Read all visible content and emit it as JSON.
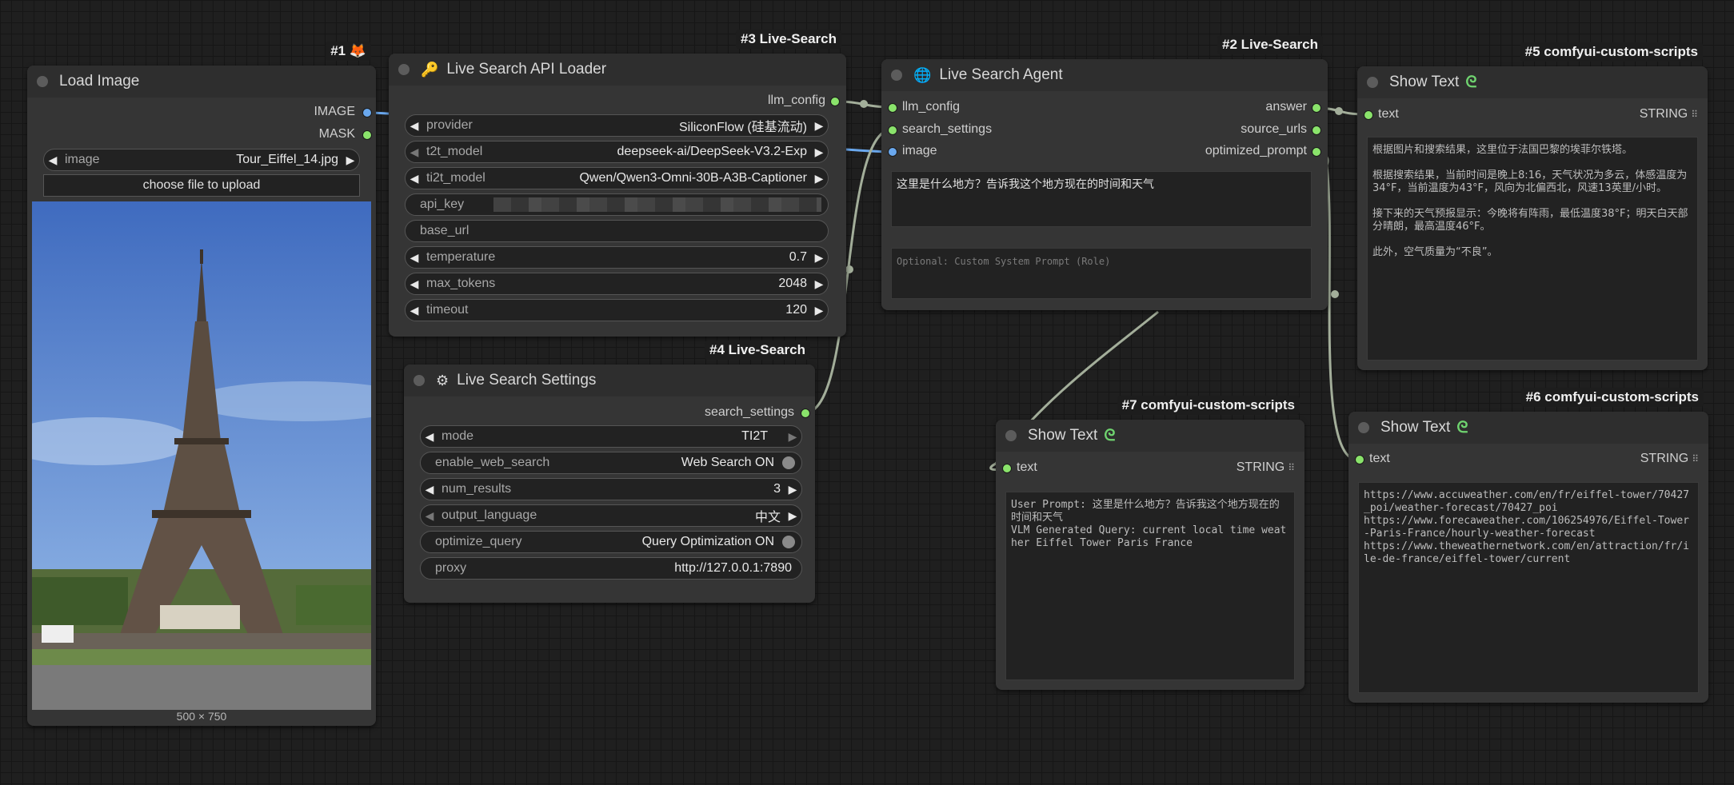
{
  "nodes": {
    "load_image": {
      "badge": "#1 🦊",
      "title": "Load Image",
      "outputs": [
        "IMAGE",
        "MASK"
      ],
      "image_widget": {
        "label": "image",
        "value": "Tour_Eiffel_14.jpg"
      },
      "upload_button": "choose file to upload",
      "image_size": "500 × 750"
    },
    "api_loader": {
      "badge": "#3 Live-Search",
      "title": "Live Search API Loader",
      "icon": "key-icon",
      "output": "llm_config",
      "widgets": [
        {
          "label": "provider",
          "value": "SiliconFlow (硅基流动)"
        },
        {
          "label": "t2t_model",
          "value": "deepseek-ai/DeepSeek-V3.2-Exp"
        },
        {
          "label": "ti2t_model",
          "value": "Qwen/Qwen3-Omni-30B-A3B-Captioner"
        },
        {
          "label": "api_key",
          "value": ""
        },
        {
          "label": "base_url",
          "value": ""
        },
        {
          "label": "temperature",
          "value": "0.7"
        },
        {
          "label": "max_tokens",
          "value": "2048"
        },
        {
          "label": "timeout",
          "value": "120"
        }
      ]
    },
    "settings": {
      "badge": "#4 Live-Search",
      "title": "Live Search Settings",
      "icon": "gear-icon",
      "output": "search_settings",
      "widgets": [
        {
          "label": "mode",
          "value": "TI2T"
        },
        {
          "label": "enable_web_search",
          "value": "Web Search ON"
        },
        {
          "label": "num_results",
          "value": "3"
        },
        {
          "label": "output_language",
          "value": "中文"
        },
        {
          "label": "optimize_query",
          "value": "Query Optimization ON"
        },
        {
          "label": "proxy",
          "value": "http://127.0.0.1:7890"
        }
      ]
    },
    "agent": {
      "badge": "#2 Live-Search",
      "title": "Live Search Agent",
      "icon": "globe-icon",
      "inputs": [
        "llm_config",
        "search_settings",
        "image"
      ],
      "outputs": [
        "answer",
        "source_urls",
        "optimized_prompt"
      ],
      "prompt": "这里是什么地方？告诉我这个地方现在的时间和天气",
      "system_prompt_placeholder": "Optional: Custom System Prompt (Role)"
    },
    "show5": {
      "badge": "#5 comfyui-custom-scripts",
      "title": "Show Text",
      "input": "text",
      "type": "STRING",
      "content": "根据图片和搜索结果，这里位于法国巴黎的埃菲尔铁塔。\n\n根据搜索结果，当前时间是晚上8:16，天气状况为多云，体感温度为34°F，当前温度为43°F，风向为北偏西北，风速13英里/小时。\n\n接下来的天气预报显示：今晚将有阵雨，最低温度38°F；明天白天部分晴朗，最高温度46°F。\n\n此外，空气质量为“不良”。"
    },
    "show6": {
      "badge": "#6 comfyui-custom-scripts",
      "title": "Show Text",
      "input": "text",
      "type": "STRING",
      "content": "https://www.accuweather.com/en/fr/eiffel-tower/70427_poi/weather-forecast/70427_poi\nhttps://www.forecaweather.com/106254976/Eiffel-Tower-Paris-France/hourly-weather-forecast\nhttps://www.theweathernetwork.com/en/attraction/fr/ile-de-france/eiffel-tower/current"
    },
    "show7": {
      "badge": "#7 comfyui-custom-scripts",
      "title": "Show Text",
      "input": "text",
      "type": "STRING",
      "content": "User Prompt: 这里是什么地方？告诉我这个地方现在的时间和天气\nVLM Generated Query: current local time weather Eiffel Tower Paris France"
    }
  },
  "colors": {
    "link_green": "#a3ae9a",
    "link_blue": "#6aa8ee",
    "slot_green": "#8ae36b"
  }
}
